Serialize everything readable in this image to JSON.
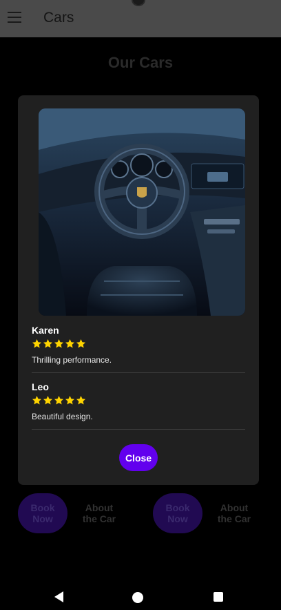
{
  "appbar": {
    "title": "Cars",
    "menu_icon": "menu-icon"
  },
  "page": {
    "heading": "Our Cars"
  },
  "modal": {
    "image_alt_icon": "car-interior-image",
    "reviews": [
      {
        "name": "Karen",
        "rating": 5,
        "comment": "Thrilling performance."
      },
      {
        "name": "Leo",
        "rating": 5,
        "comment": "Beautiful design."
      }
    ],
    "close_label": "Close"
  },
  "background_cards": [
    {
      "book_label": "Book\nNow",
      "about_label": "About\nthe Car"
    },
    {
      "book_label": "Book\nNow",
      "about_label": "About\nthe Car"
    }
  ],
  "colors": {
    "accent": "#6200ee",
    "star": "#ffd400",
    "modal_bg": "#202020"
  },
  "navbar": {
    "icons": [
      "back-icon",
      "home-icon",
      "recents-icon"
    ]
  }
}
